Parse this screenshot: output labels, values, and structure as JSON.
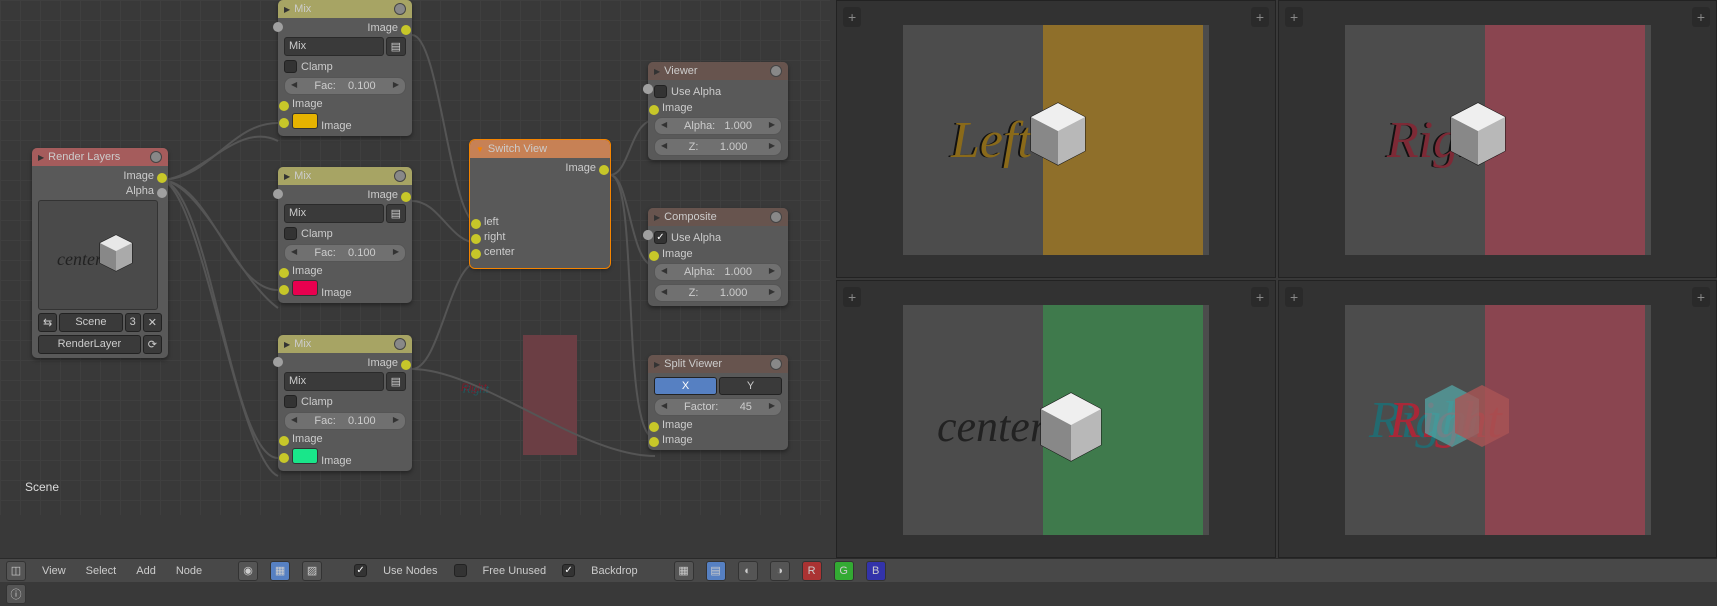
{
  "scene_label": "Scene",
  "render_layers": {
    "title": "Render Layers",
    "out_image": "Image",
    "out_alpha": "Alpha",
    "thumb_text": "center",
    "scene_btn": "Scene",
    "scene_num": "3",
    "layer_btn": "RenderLayer"
  },
  "mix1": {
    "title": "Mix",
    "out": "Image",
    "mode": "Mix",
    "clamp": "Clamp",
    "fac_label": "Fac:",
    "fac": "0.100",
    "in_image_a": "Image",
    "in_image_b": "Image",
    "swatch": "#e6b300"
  },
  "mix2": {
    "title": "Mix",
    "out": "Image",
    "mode": "Mix",
    "clamp": "Clamp",
    "fac_label": "Fac:",
    "fac": "0.100",
    "in_image_a": "Image",
    "in_image_b": "Image",
    "swatch": "#e8004f"
  },
  "mix3": {
    "title": "Mix",
    "out": "Image",
    "mode": "Mix",
    "clamp": "Clamp",
    "fac_label": "Fac:",
    "fac": "0.100",
    "in_image_a": "Image",
    "in_image_b": "Image",
    "swatch": "#19e68a"
  },
  "switch": {
    "title": "Switch View",
    "out": "Image",
    "in1": "left",
    "in2": "right",
    "in3": "center"
  },
  "viewer": {
    "title": "Viewer",
    "use_alpha": "Use Alpha",
    "image": "Image",
    "alpha_l": "Alpha:",
    "alpha_v": "1.000",
    "z_l": "Z:",
    "z_v": "1.000"
  },
  "composite": {
    "title": "Composite",
    "use_alpha": "Use Alpha",
    "image": "Image",
    "alpha_l": "Alpha:",
    "alpha_v": "1.000",
    "z_l": "Z:",
    "z_v": "1.000"
  },
  "split": {
    "title": "Split Viewer",
    "x": "X",
    "y": "Y",
    "factor_l": "Factor:",
    "factor_v": "45",
    "img1": "Image",
    "img2": "Image"
  },
  "header": {
    "menus": [
      "View",
      "Select",
      "Add",
      "Node"
    ],
    "use_nodes": "Use Nodes",
    "free_unused": "Free Unused",
    "backdrop": "Backdrop"
  },
  "backdrop_text": "Right",
  "vp": {
    "left_text": "Left",
    "right_text": "Right",
    "center_text": "center",
    "overlay_left": "#8f6f2a",
    "overlay_right": "#8a4550",
    "overlay_center": "#3f7a4c"
  }
}
